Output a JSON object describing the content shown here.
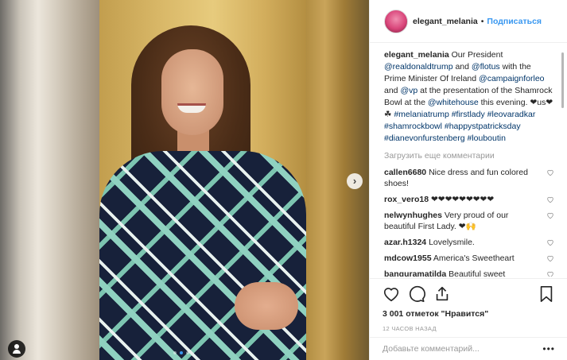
{
  "post": {
    "username": "elegant_melania",
    "follow_label": "Подписаться",
    "separator": "•",
    "caption_parts": {
      "text1": " Our President ",
      "mention1": "@realdonaldtrump",
      "text2": " and ",
      "mention2": "@flotus",
      "text3": " with the Prime Minister Of Ireland ",
      "mention3": "@campaignforleo",
      "text4": " and ",
      "mention4": "@vp",
      "text5": " at the presentation of the Shamrock Bowl at the ",
      "mention5": "@whitehouse",
      "text6": " this evening. ❤us❤☘ ",
      "hashtags": "#melaniatrump #firstlady #leovaradkar #shamrockbowl #happystpatricksday #dianevonfurstenberg #louboutin"
    },
    "load_more": "Загрузить еще комментарии",
    "comments": [
      {
        "user": "callen6680",
        "text": "Nice dress and fun colored shoes!"
      },
      {
        "user": "rox_vero18",
        "text": "❤❤❤❤❤❤❤❤❤"
      },
      {
        "user": "nelwynhughes",
        "text": "Very proud of our beautiful First Lady. ❤🙌"
      },
      {
        "user": "azar.h1324",
        "text": "Lovelysmile."
      },
      {
        "user": "mdcow1955",
        "text": "America's Sweetheart"
      },
      {
        "user": "banquramatilda",
        "text": "Beautiful sweet"
      }
    ],
    "likes": "3 001 отметок \"Нравится\"",
    "time": "12 ЧАСОВ НАЗАД",
    "comment_placeholder": "Добавьте комментарий...",
    "more_label": "•••",
    "nav_next": "›",
    "carousel": {
      "count": 3,
      "active": 1
    }
  },
  "icons": [
    "heart-icon",
    "comment-icon",
    "share-icon",
    "bookmark-icon",
    "user-tag-icon",
    "chevron-right-icon"
  ],
  "colors": {
    "link": "#003569",
    "follow": "#3897f0",
    "muted": "#999999",
    "text": "#262626"
  }
}
